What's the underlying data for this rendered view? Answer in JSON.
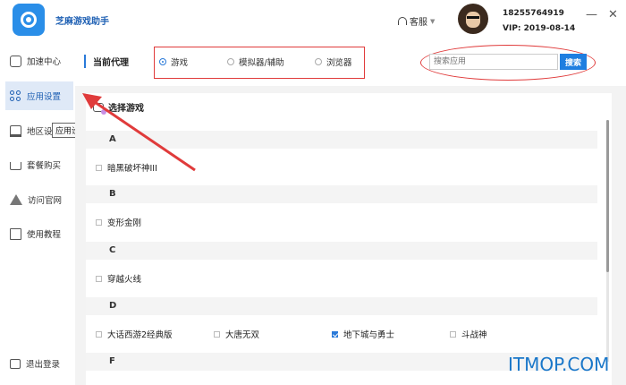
{
  "app": {
    "name": "芝麻游戏助手"
  },
  "header": {
    "service_label": "客服",
    "user_phone": "18255764919",
    "vip_text": "VIP: 2019-08-14",
    "minimize": "—",
    "close": "✕"
  },
  "sidebar": {
    "items": [
      {
        "label": "加速中心",
        "icon": "speed-icon"
      },
      {
        "label": "应用设置",
        "icon": "apps-icon"
      },
      {
        "label": "地区设",
        "icon": "region-icon"
      },
      {
        "label": "套餐购买",
        "icon": "cart-icon"
      },
      {
        "label": "访问官网",
        "icon": "home-icon"
      },
      {
        "label": "使用教程",
        "icon": "book-icon"
      }
    ],
    "logout_label": "退出登录",
    "tooltip": "应用设置"
  },
  "proxy": {
    "label": "当前代理",
    "options": [
      "游戏",
      "模拟器/辅助",
      "浏览器"
    ],
    "selected": "游戏"
  },
  "search": {
    "placeholder": "搜索应用",
    "button": "搜索"
  },
  "panel": {
    "title": "选择游戏",
    "sections": [
      {
        "letter": "A",
        "games": [
          "暗黑破坏神III"
        ]
      },
      {
        "letter": "B",
        "games": [
          "变形金刚"
        ]
      },
      {
        "letter": "C",
        "games": [
          "穿越火线"
        ]
      },
      {
        "letter": "D",
        "games": [
          "大话西游2经典版",
          "大唐无双",
          "地下城与勇士",
          "斗战神"
        ]
      },
      {
        "letter": "F",
        "games": []
      }
    ],
    "checked": [
      "地下城与勇士"
    ]
  },
  "watermark": "ITMOP.COM",
  "colors": {
    "accent": "#1f7ee0",
    "annotation": "#e03b3b",
    "active_bg": "#dfe9f7"
  }
}
